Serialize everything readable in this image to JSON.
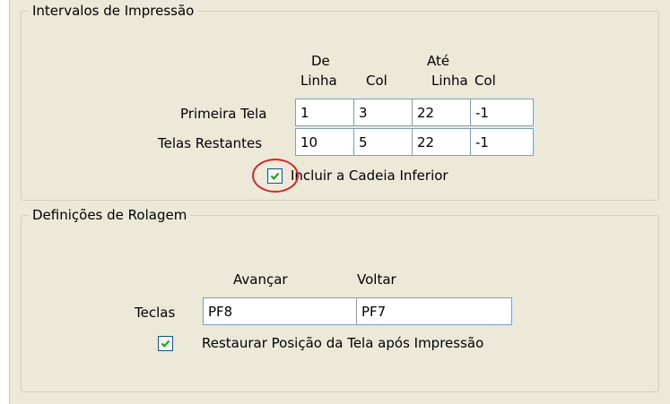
{
  "print_ranges": {
    "legend": "Intervalos de Impressão",
    "header_from": "De",
    "header_to": "Até",
    "col_headers": [
      "Linha",
      "Col",
      "Linha",
      "Col"
    ],
    "rows": [
      {
        "label": "Primeira Tela",
        "values": [
          "1",
          "3",
          "22",
          "-1"
        ]
      },
      {
        "label": "Telas Restantes",
        "values": [
          "10",
          "5",
          "22",
          "-1"
        ]
      }
    ],
    "include_bottom_chain": {
      "label": "Incluir a Cadeia Inferior",
      "checked": true
    }
  },
  "scroll_settings": {
    "legend": "Definições de Rolagem",
    "forward_label": "Avançar",
    "back_label": "Voltar",
    "keys_label": "Teclas",
    "forward_value": "PF8",
    "back_value": "PF7",
    "restore_position": {
      "label": "Restaurar Posição da Tela após Impressão",
      "checked": true
    }
  },
  "colors": {
    "panel": "#ece9d8",
    "field_border": "#7f9db9",
    "check_mark": "#21a121",
    "highlight": "#d8232a"
  }
}
